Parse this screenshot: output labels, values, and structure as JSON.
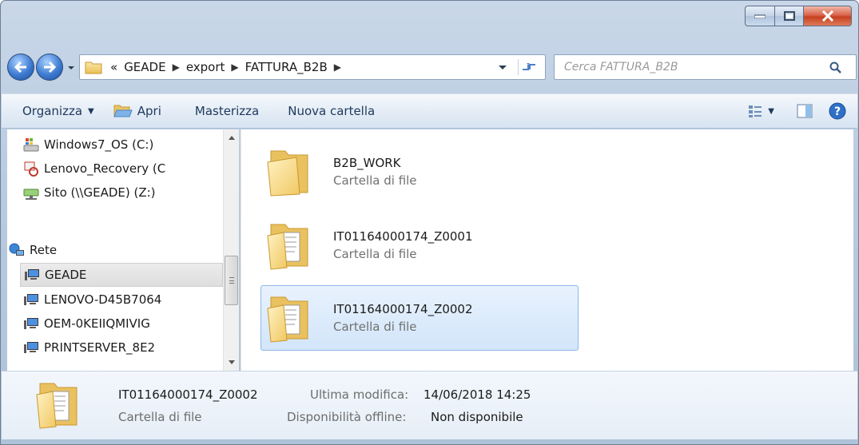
{
  "address": {
    "overflow": "«",
    "crumbs": [
      "GEADE",
      "export",
      "FATTURA_B2B"
    ]
  },
  "search": {
    "placeholder": "Cerca FATTURA_B2B"
  },
  "toolbar": {
    "organize_label": "Organizza",
    "open_label": "Apri",
    "burn_label": "Masterizza",
    "new_folder_label": "Nuova cartella"
  },
  "navigation": {
    "items": [
      {
        "label": "Windows7_OS (C:)",
        "icon": "hard-drive-icon"
      },
      {
        "label": "Lenovo_Recovery (C",
        "icon": "recovery-drive-icon"
      },
      {
        "label": "Sito (\\\\GEADE) (Z:)",
        "icon": "network-drive-icon"
      },
      {
        "label": "Rete",
        "icon": "network-icon"
      },
      {
        "label": "GEADE",
        "icon": "computer-icon"
      },
      {
        "label": "LENOVO-D45B7064",
        "icon": "computer-icon"
      },
      {
        "label": "OEM-0KEIIQMIVIG",
        "icon": "computer-icon"
      },
      {
        "label": "PRINTSERVER_8E2",
        "icon": "computer-icon"
      }
    ]
  },
  "files": [
    {
      "name": "B2B_WORK",
      "type": "Cartella di file",
      "icon": "folder-icon"
    },
    {
      "name": "IT01164000174_Z0001",
      "type": "Cartella di file",
      "icon": "folder-with-documents-icon"
    },
    {
      "name": "IT01164000174_Z0002",
      "type": "Cartella di file",
      "icon": "folder-with-documents-icon"
    }
  ],
  "details": {
    "name": "IT01164000174_Z0002",
    "type": "Cartella di file",
    "modified_label": "Ultima modifica:",
    "modified_value": "14/06/2018 14:25",
    "offline_label": "Disponibilità offline:",
    "offline_value": "Non disponibile"
  },
  "colors": {
    "selection_fill": "#d2e5fa",
    "selection_border": "#8fb8e6",
    "close_button": "#c6401f",
    "toolbar_text": "#1e395b"
  }
}
